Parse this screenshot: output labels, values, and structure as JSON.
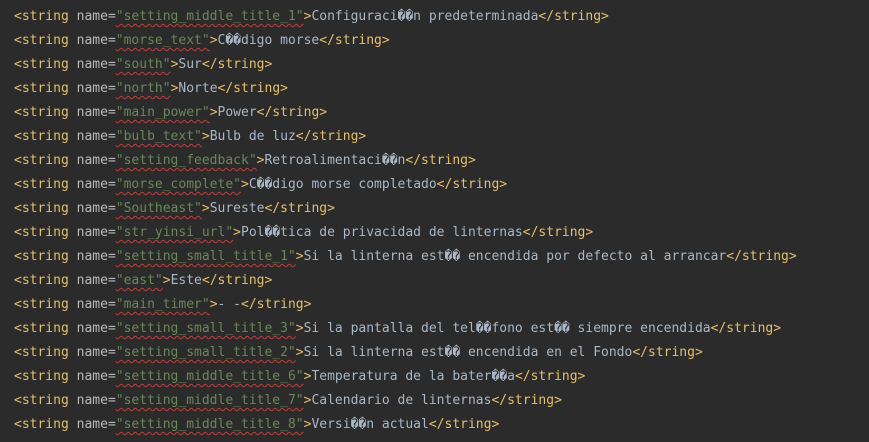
{
  "editor": {
    "background": "#2b2b2b",
    "colors": {
      "tag": "#e8bf6a",
      "attribute": "#bababa",
      "value": "#6a8759",
      "text": "#a9b7c6",
      "spellcheck_underline": "#bc3f3c"
    },
    "lines": [
      {
        "open_tag": "<string",
        "attr": " name",
        "eq": "=",
        "value": "\"setting_middle_title_1\"",
        "close_open": ">",
        "text": "Configuraci��n predeterminada",
        "end_tag": "</string>"
      },
      {
        "open_tag": "<string",
        "attr": " name",
        "eq": "=",
        "value": "\"morse_text\"",
        "close_open": ">",
        "text": "C��digo morse",
        "end_tag": "</string>"
      },
      {
        "open_tag": "<string",
        "attr": " name",
        "eq": "=",
        "value": "\"south\"",
        "close_open": ">",
        "text": "Sur",
        "end_tag": "</string>"
      },
      {
        "open_tag": "<string",
        "attr": " name",
        "eq": "=",
        "value": "\"north\"",
        "close_open": ">",
        "text": "Norte",
        "end_tag": "</string>"
      },
      {
        "open_tag": "<string",
        "attr": " name",
        "eq": "=",
        "value": "\"main_power\"",
        "close_open": ">",
        "text": "Power",
        "end_tag": "</string>"
      },
      {
        "open_tag": "<string",
        "attr": " name",
        "eq": "=",
        "value": "\"bulb_text\"",
        "close_open": ">",
        "text": "Bulb de luz",
        "end_tag": "</string>"
      },
      {
        "open_tag": "<string",
        "attr": " name",
        "eq": "=",
        "value": "\"setting_feedback\"",
        "close_open": ">",
        "text": "Retroalimentaci��n",
        "end_tag": "</string>"
      },
      {
        "open_tag": "<string",
        "attr": " name",
        "eq": "=",
        "value": "\"morse_complete\"",
        "close_open": ">",
        "text": "C��digo morse completado",
        "end_tag": "</string>"
      },
      {
        "open_tag": "<string",
        "attr": " name",
        "eq": "=",
        "value": "\"Southeast\"",
        "close_open": ">",
        "text": "Sureste",
        "end_tag": "</string>"
      },
      {
        "open_tag": "<string",
        "attr": " name",
        "eq": "=",
        "value": "\"str_yinsi_url\"",
        "close_open": ">",
        "text": "Pol��tica de privacidad de linternas",
        "end_tag": "</string>"
      },
      {
        "open_tag": "<string",
        "attr": " name",
        "eq": "=",
        "value": "\"setting_small_title_1\"",
        "close_open": ">",
        "text": "Si la linterna est�� encendida por defecto al arrancar",
        "end_tag": "</string>"
      },
      {
        "open_tag": "<string",
        "attr": " name",
        "eq": "=",
        "value": "\"east\"",
        "close_open": ">",
        "text": "Este",
        "end_tag": "</string>"
      },
      {
        "open_tag": "<string",
        "attr": " name",
        "eq": "=",
        "value": "\"main_timer\"",
        "close_open": ">",
        "text": "- -",
        "end_tag": "</string>"
      },
      {
        "open_tag": "<string",
        "attr": " name",
        "eq": "=",
        "value": "\"setting_small_title_3\"",
        "close_open": ">",
        "text": "Si la pantalla del tel��fono est�� siempre encendida",
        "end_tag": "</string>"
      },
      {
        "open_tag": "<string",
        "attr": " name",
        "eq": "=",
        "value": "\"setting_small_title_2\"",
        "close_open": ">",
        "text": "Si la linterna est�� encendida en el Fondo",
        "end_tag": "</string>"
      },
      {
        "open_tag": "<string",
        "attr": " name",
        "eq": "=",
        "value": "\"setting_middle_title_6\"",
        "close_open": ">",
        "text": "Temperatura de la bater��a",
        "end_tag": "</string>"
      },
      {
        "open_tag": "<string",
        "attr": " name",
        "eq": "=",
        "value": "\"setting_middle_title_7\"",
        "close_open": ">",
        "text": "Calendario de linternas",
        "end_tag": "</string>"
      },
      {
        "open_tag": "<string",
        "attr": " name",
        "eq": "=",
        "value": "\"setting_middle_title_8\"",
        "close_open": ">",
        "text": "Versi��n actual",
        "end_tag": "</string>"
      }
    ]
  }
}
